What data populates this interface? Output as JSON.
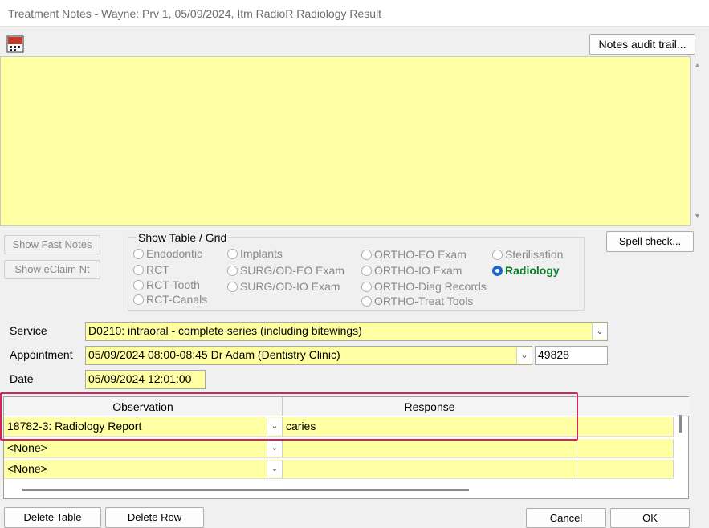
{
  "window": {
    "title": "Treatment Notes - Wayne: Prv 1, 05/09/2024, Itm RadioR Radiology Result"
  },
  "toolbar": {
    "notes_audit_label": "Notes audit trail...",
    "spell_check_label": "Spell check..."
  },
  "notes": {
    "value": ""
  },
  "side_buttons": {
    "fast_notes": "Show Fast Notes",
    "eclaim": "Show eClaim Nt"
  },
  "show_table": {
    "title": "Show Table / Grid",
    "options": [
      "Endodontic",
      "RCT",
      "RCT-Tooth",
      "RCT-Canals",
      "Implants",
      "SURG/OD-EO Exam",
      "SURG/OD-IO Exam",
      "ORTHO-EO Exam",
      "ORTHO-IO Exam",
      "ORTHO-Diag Records",
      "ORTHO-Treat Tools",
      "Sterilisation",
      "Radiology"
    ],
    "selected": "Radiology"
  },
  "form": {
    "service_label": "Service",
    "service_value": "D0210: intraoral - complete series (including bitewings)",
    "appointment_label": "Appointment",
    "appointment_value": "05/09/2024 08:00-08:45 Dr Adam (Dentistry Clinic)",
    "appointment_id": "49828",
    "date_label": "Date",
    "date_value": "05/09/2024 12:01:00"
  },
  "grid": {
    "columns": [
      "Observation",
      "Response"
    ],
    "rows": [
      {
        "observation": "18782-3: Radiology Report",
        "response": "caries"
      },
      {
        "observation": "<None>",
        "response": ""
      },
      {
        "observation": "<None>",
        "response": ""
      }
    ]
  },
  "bottom_buttons": {
    "delete_table": "Delete Table",
    "delete_row": "Delete Row",
    "cancel": "Cancel",
    "ok": "OK"
  },
  "colors": {
    "note_yellow": "#ffffa3",
    "selected_radio_text": "#0e7d2b",
    "highlight_border": "#d0245a"
  }
}
